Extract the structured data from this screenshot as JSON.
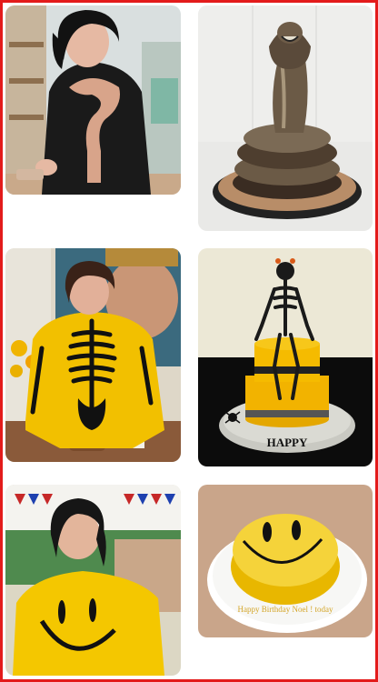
{
  "grid": {
    "frame_color": "#e31b1b",
    "tiles": [
      {
        "id": "r1-left",
        "subject": "person-in-snake-sweater"
      },
      {
        "id": "r1-right",
        "subject": "cobra-cake"
      },
      {
        "id": "r2-left",
        "subject": "person-in-skeleton-suit"
      },
      {
        "id": "r2-right",
        "subject": "skeleton-cake"
      },
      {
        "id": "r3-left",
        "subject": "person-in-smiley-sweater"
      },
      {
        "id": "r3-right",
        "subject": "smiley-cake"
      }
    ]
  },
  "smiley_cake": {
    "inscription": "Happy Birthday Noel ! today"
  },
  "skeleton_cake": {
    "board_letters": "HAPPY"
  },
  "colors": {
    "yellow": "#f2c000",
    "black": "#111111",
    "red": "#e31b1b"
  }
}
